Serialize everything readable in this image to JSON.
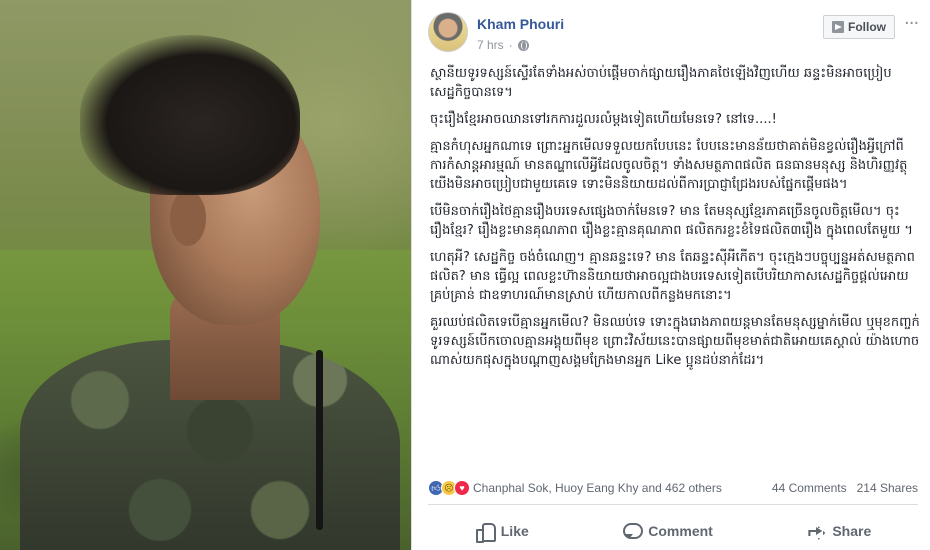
{
  "post": {
    "author": "Kham Phouri",
    "timestamp": "7 hrs",
    "privacy_icon": "globe-icon",
    "follow_label": "Follow",
    "more_label": "···",
    "paragraphs": [
      "ស្ថានីយទូរទស្សន៍ស្ទើរតែទាំងអស់ចាប់ផ្ដើមចាក់ផ្សាយរឿងភាគថៃឡើងវិញហើយ ឆន្ទះមិនអាចប្រៀបសេដ្ឋកិច្ចបានទេ។",
      "ចុះរឿងខ្មែរអាចឈានទៅរកការដួលរលំម្ដងទៀតហើយមែនទេ? នៅទេ....!",
      "គ្មានកំហុសអ្នកណាទេ ព្រោះអ្នកមើលទទួលយកបែបនេះ បែបនេះមានន័យថាគាត់មិនខ្វល់រឿងអ្វីក្រៅពីការកំសាន្តអារម្មណ៍ មានតណ្ហាលើអ្វីដែលចូលចិត្ត។ ទាំងសមត្ថភាពផលិត ធនធានមនុស្ស និងហិរញ្ញវត្ថុ យើងមិនអាចប្រៀបជាមួយគេទេ ទោះមិននិយាយដល់ពីការប្រាជ្ញាជ្រែងរបស់ផ្នែកផ្ដើមផង។",
      "បើមិនចាក់រឿងថៃគ្មានរឿងបរទេសផ្សេងចាក់មែនទេ? មាន តែមនុស្សខ្មែរភាគច្រើនចូលចិត្តមើល។ ចុះរឿងខ្មែរ? រឿងខ្លះមានគុណភាព រឿងខ្លះគ្មានគុណភាព ផលិតករខ្លះខំទៃផលិត៣រឿង ក្នុងពេលតែមួយ ។",
      "ហេតុអី? សេដ្ឋកិច្ច ចង់ចំណេញ។ គ្មានឆន្ទះទេ? មាន តែឆន្ទះស៊ីអីកើត។ ចុះក្មេងៗបច្ចុប្បន្នអត់សមត្ថភាពផលិត? មាន ធ្វើល្អ ពេលខ្លះហ៊ាននិយាយថាអាចល្អជាងបរទេសទៀតបើបរិយាកាសសេដ្ឋកិច្ចផ្ដល់អោយគ្រប់គ្រាន់ ជាឧទាហរណ៍មានស្រាប់ ហើយកាលពីកន្លងមកនោះ។",
      "គួរឈប់ផលិតទេបើគ្មានអ្នកមើល? មិនឈប់ទេ ទោះក្នុងរោងភាពយន្តមានតែមនុស្សម្នាក់មើល ឬមុខកញ្ចក់ទូរទស្សន៍បើកចោលគ្មានអង្គុយពីមុខ ព្រោះវិស័យនេះបានផ្សាយពីមុខមាត់ជាតិអោយគេស្គាល់ យ៉ាងហោចណាស់យកផុសក្នុងបណ្ដាញសង្គមក្រែងមានអ្នក Like ប្អូនដប់នាក់ដែរ។"
    ]
  },
  "stats": {
    "reactions": [
      "like",
      "sad",
      "love"
    ],
    "names": "Chanphal Sok, Huoy Eang Khy and 462 others",
    "comments": "44 Comments",
    "shares": "214 Shares"
  },
  "actions": {
    "like": "Like",
    "comment": "Comment",
    "share": "Share"
  },
  "colors": {
    "link": "#365899",
    "muted": "#90949c",
    "text": "#1d2129",
    "like_blue": "#4267b2",
    "love_red": "#f0284a"
  }
}
